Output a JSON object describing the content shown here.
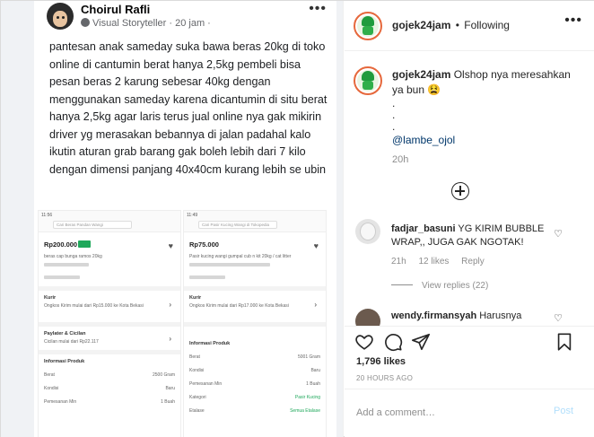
{
  "fb_post": {
    "author": "Choirul Rafli",
    "meta": "Visual Storyteller · 20 jam ·",
    "more": "•••",
    "text": "pantesan anak sameday suka bawa beras 20kg di toko online di cantumin berat hanya 2,5kg pembeli bisa pesan beras 2 karung sebesar 40kg dengan menggunakan sameday karena dicantumin di situ berat hanya 2,5kg agar laris terus jual online nya gak mikirin driver yg merasakan bebannya di jalan padahal kalo ikutin aturan grab barang gak boleh lebih dari 7 kilo dengan dimensi panjang 40x40cm kurang lebih se ubin",
    "shot1": {
      "time": "11:56",
      "search": "Cari Beras Pandan Wangi",
      "price": "Rp200.000",
      "title": "beras cap bunga ramos 20kg",
      "kurir": "Kurir",
      "ongkir": "Ongkos Kirim mulai dari Rp15.000 ke Kota Bekasi",
      "paylater": "Paylater & Cicilan",
      "cicilan": "Cicilan mulai dari Rp22.117",
      "info": "Informasi Produk",
      "berat_label": "Berat",
      "berat_value": "2500 Gram",
      "kondisi_label": "Kondisi",
      "kondisi_value": "Baru",
      "min_label": "Pemesanan Min",
      "min_value": "1 Buah"
    },
    "shot2": {
      "time": "11:49",
      "search": "Cari Pasir Kucing Wangi di Tokopedia",
      "price": "Rp75.000",
      "title": "Pasir kucing wangi gumpal cub n kit 20kg / cat litter",
      "kurir": "Kurir",
      "ongkir": "Ongkos Kirim mulai dari Rp17.000 ke Kota Bekasi",
      "info": "Informasi Produk",
      "berat_label": "Berat",
      "berat_value": "5001 Gram",
      "kondisi_label": "Kondisi",
      "kondisi_value": "Baru",
      "min_label": "Pemesanan Min",
      "min_value": "1 Buah",
      "kategori_label": "Kategori",
      "kategori_value": "Pasir Kucing",
      "etalase_label": "Etalase",
      "etalase_value": "Semua Etalase"
    }
  },
  "header": {
    "username": "gojek24jam",
    "dot": "•",
    "follow_status": "Following",
    "more": "•••"
  },
  "caption": {
    "username": "gojek24jam",
    "text": "Olshop nya meresahkan ya bun 😫",
    "dots": [
      ".",
      ".",
      "."
    ],
    "mention": "@lambe_ojol",
    "time": "20h"
  },
  "comments": [
    {
      "username": "fadjar_basuni",
      "text": "YG KIRIM BUBBLE WRAP,, JUGA GAK NGOTAK!",
      "time": "21h",
      "likes": "12 likes",
      "reply": "Reply",
      "view_replies": "View replies (22)"
    },
    {
      "username": "wendy.firmansyah",
      "text": "Harusnya"
    }
  ],
  "post": {
    "likes": "1,796 likes",
    "ago": "20 HOURS AGO",
    "comment_placeholder": "Add a comment…",
    "post_label": "Post"
  },
  "colors": {
    "accent": "#0095f6",
    "post_disabled": "#b2dffc",
    "muted": "#8e8e8e",
    "mention": "#00376b",
    "tokopedia_green": "#1fa85b"
  }
}
